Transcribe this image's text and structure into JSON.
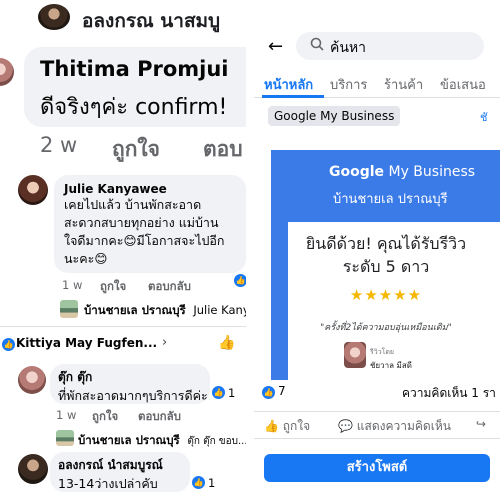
{
  "left": {
    "top_comment": {
      "author_name": "อลงกรณ นาสมบู",
      "reply_author": "Thitima Promjui",
      "reply_text": "ดีจริงๆค่ะ confirm!",
      "time": "2 w",
      "like": "ถูกใจ",
      "reply": "ตอบ"
    },
    "julie": {
      "name": "Julie Kanyawee",
      "lines": [
        "เคยไปแล้ว  บ้านพักสะอาด",
        "สะดวกสบายทุกอย่าง แม่บ้าน",
        "ใจดีมากคะ😊มีโอกาสจะไปอีก",
        "นะคะ😊"
      ],
      "time": "1 w",
      "like": "ถูกใจ",
      "reply": "ตอบกลับ",
      "reaction_count": "1"
    },
    "julie_reply": {
      "page_name": "บ้านชายเล ปราณบุรี",
      "preview": "Julie Kany"
    },
    "thread": {
      "title": "Kittiya May Fugfen...",
      "chevron": "›"
    },
    "tuk": {
      "name": "ตุ๊ก ตุ๊ก",
      "text": "ที่พักสะอาดมากๆบริการดีค่ะ",
      "time": "1 w",
      "like": "ถูกใจ",
      "reply": "ตอบกลับ",
      "reaction_count": "1"
    },
    "tuk_reply": {
      "page_name": "บ้านชายเล ปราณบุรี",
      "preview": "ตุ๊ก ตุ๊ก ขอบ..."
    },
    "alongkorn": {
      "name": "อลงกรณ์ นำสมบูรณ์",
      "text": "13-14ว่างเปล่าคับ",
      "reaction_count": "1"
    }
  },
  "right": {
    "search": {
      "placeholder": "ค้นหา"
    },
    "tabs": [
      {
        "label": "หน้าหลัก",
        "active": true
      },
      {
        "label": "บริการ",
        "active": false
      },
      {
        "label": "ร้านค้า",
        "active": false
      },
      {
        "label": "ข้อเสนอ",
        "active": false
      }
    ],
    "chip": "Google My Business",
    "chip_more": "ชั",
    "card": {
      "brand_google": "Google",
      "brand_rest": " My Business",
      "subtitle": "บ้านชายเล ปราณบุรี",
      "headline_1": "ยินดีด้วย! คุณได้รับรีวิว",
      "headline_2": "ระดับ 5 ดาว",
      "stars": "★★★★★",
      "quote": "\"ครั้งที่2ได้ความอบอุ่นเหมือนเดิม\"",
      "reviewer_label": "รีวิวโดย",
      "reviewer_name": "ชัยวาล มีสดี"
    },
    "stats": {
      "likes": "7",
      "comments": "ความคิดเห็น 1 รา"
    },
    "actions": {
      "like": "ถูกใจ",
      "comment": "แสดงความคิดเห็น"
    },
    "create_post": "สร้างโพสต์"
  },
  "colors": {
    "fb_blue": "#1877f2",
    "bubble_grey": "#f0f2f5",
    "card_blue": "#3b7be8",
    "star_gold": "#f5b800"
  }
}
